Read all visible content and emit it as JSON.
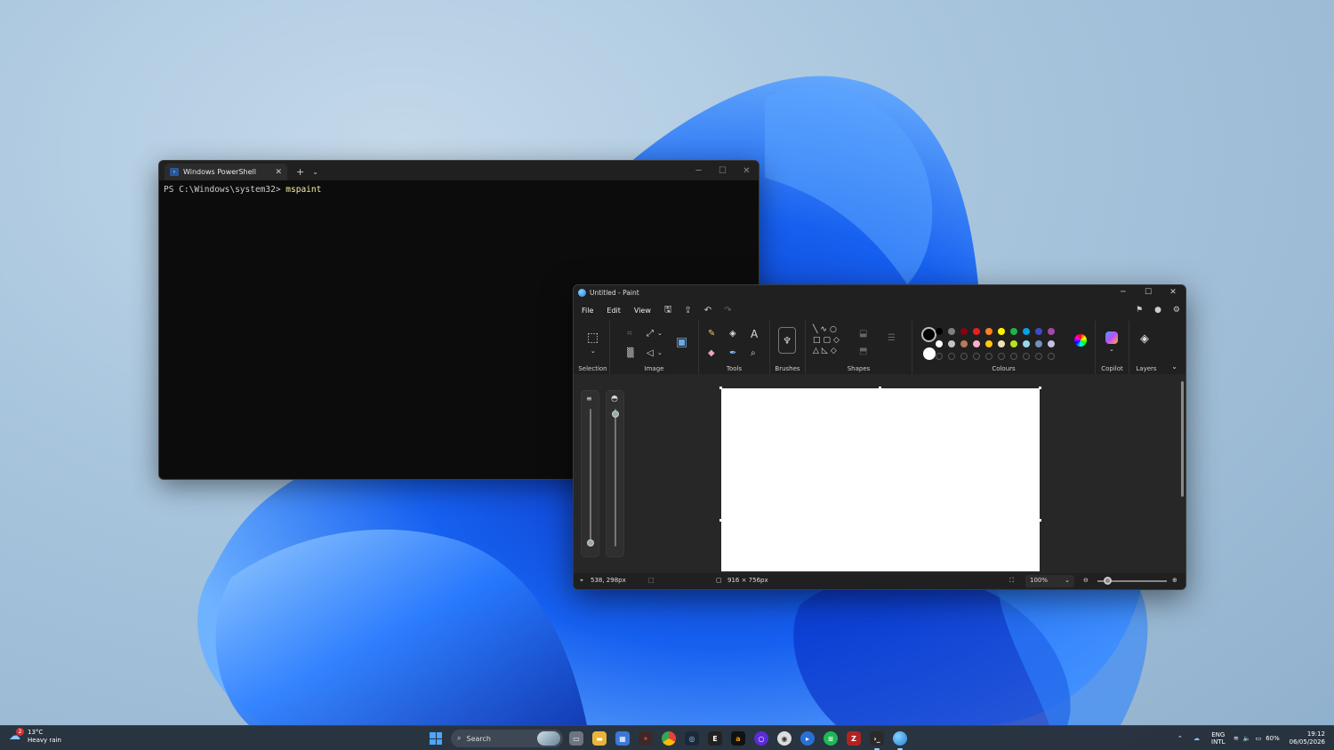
{
  "terminal": {
    "tab_title": "Windows PowerShell",
    "new_tab_glyph": "+",
    "prompt": "PS C:\\Windows\\system32> ",
    "command": "mspaint"
  },
  "paint": {
    "title": "Untitled - Paint",
    "menu": {
      "file": "File",
      "edit": "Edit",
      "view": "View"
    },
    "ribbon": {
      "selection": "Selection",
      "image": "Image",
      "tools": "Tools",
      "brushes": "Brushes",
      "shapes": "Shapes",
      "colours": "Colours",
      "copilot": "Copilot",
      "layers": "Layers"
    },
    "palette_row1": [
      "#000000",
      "#7f7f7f",
      "#880015",
      "#ed1c24",
      "#ff7f27",
      "#fff200",
      "#22b14c",
      "#00a2e8",
      "#3f48cc",
      "#a349a4"
    ],
    "palette_row2": [
      "#ffffff",
      "#c3c3c3",
      "#b97a57",
      "#ffaec9",
      "#ffc90e",
      "#efe4b0",
      "#b5e61d",
      "#99d9ea",
      "#7092be",
      "#c8bfe7"
    ],
    "primary_colour": "#000000",
    "secondary_colour": "#ffffff",
    "status": {
      "cursor_pos": "538, 298px",
      "canvas_size": "916 × 756px",
      "zoom": "100%"
    }
  },
  "taskbar": {
    "weather_temp": "13°C",
    "weather_desc": "Heavy rain",
    "weather_badge": "2",
    "search_label": "Search",
    "lang_line1": "ENG",
    "lang_line2": "INTL",
    "battery": "60%",
    "time": "19:12",
    "date": "06/05/2026"
  },
  "colors": {
    "accent": "#4aa6ff",
    "chrome_bg": "#1f1f1f",
    "terminal_bg": "#0c0c0c"
  }
}
